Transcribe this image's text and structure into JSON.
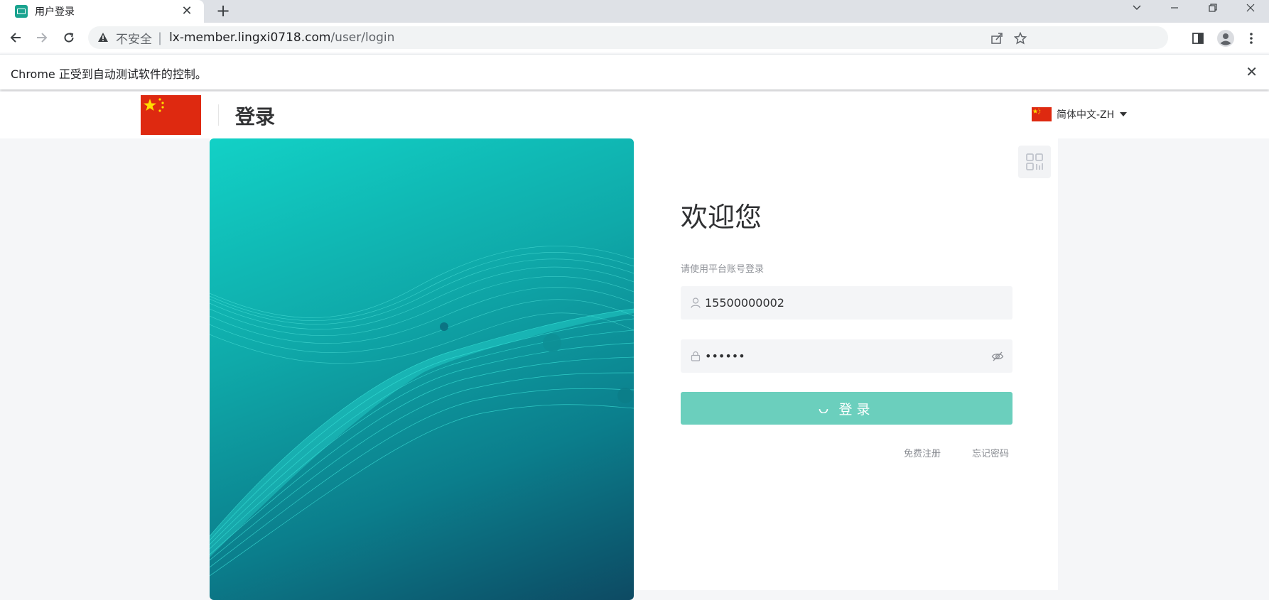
{
  "browser": {
    "tab_title": "用户登录",
    "tab_close": "✕",
    "new_tab": "+",
    "security_label": "不安全",
    "url_host": "lx-member.lingxi0718.com",
    "url_path": "/user/login",
    "infobar_text": "Chrome 正受到自动测试软件的控制。",
    "infobar_close": "✕"
  },
  "header": {
    "title": "登录",
    "language": "简体中文-ZH"
  },
  "login": {
    "welcome": "欢迎您",
    "subtitle": "请使用平台账号登录",
    "username_value": "15500000002",
    "password_value": "••••••",
    "submit_label": "登录",
    "register_link": "免费注册",
    "forgot_link": "忘记密码"
  },
  "colors": {
    "primary": "#6bcfbd",
    "flag_red": "#de2910",
    "flag_yellow": "#ffde00"
  },
  "icons": {
    "tab_favicon": "demo-favicon",
    "username": "user-icon",
    "password": "lock-icon",
    "password_toggle": "eye-off-icon",
    "qr_toggle": "qrcode-icon",
    "login_loading": "spinner-icon"
  }
}
